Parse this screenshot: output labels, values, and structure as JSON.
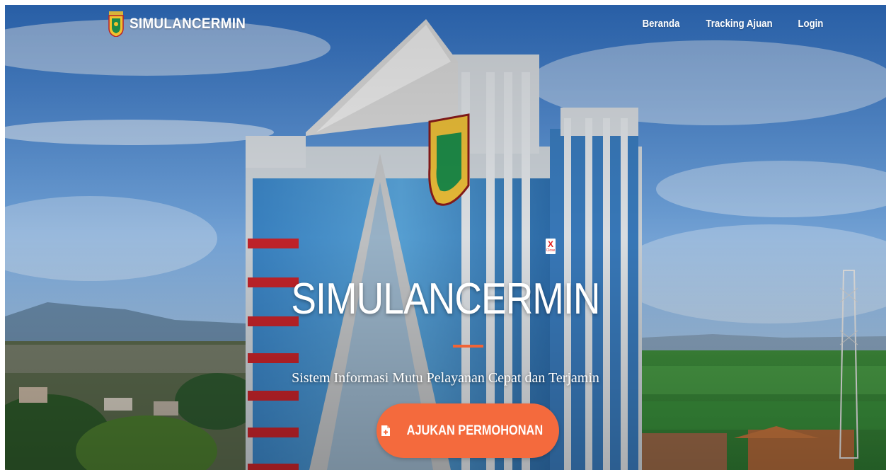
{
  "brand": {
    "name": "SIMULANCERMIN"
  },
  "nav": {
    "items": [
      "Beranda",
      "Tracking Ajuan",
      "Login"
    ]
  },
  "hero": {
    "title": "SIMULANCERMIN",
    "subtitle": "Sistem Informasi Mutu Pelayanan Cepat dan Terjamin",
    "cta_label": "AJUKAN PERMOHONAN",
    "cta_icon": "file-plus-icon"
  },
  "close_badge": {
    "mark": "X",
    "label": "Close"
  },
  "colors": {
    "accent": "#f46a3d",
    "divider": "#f16436",
    "close": "#e01e1e",
    "text": "#ffffff"
  }
}
